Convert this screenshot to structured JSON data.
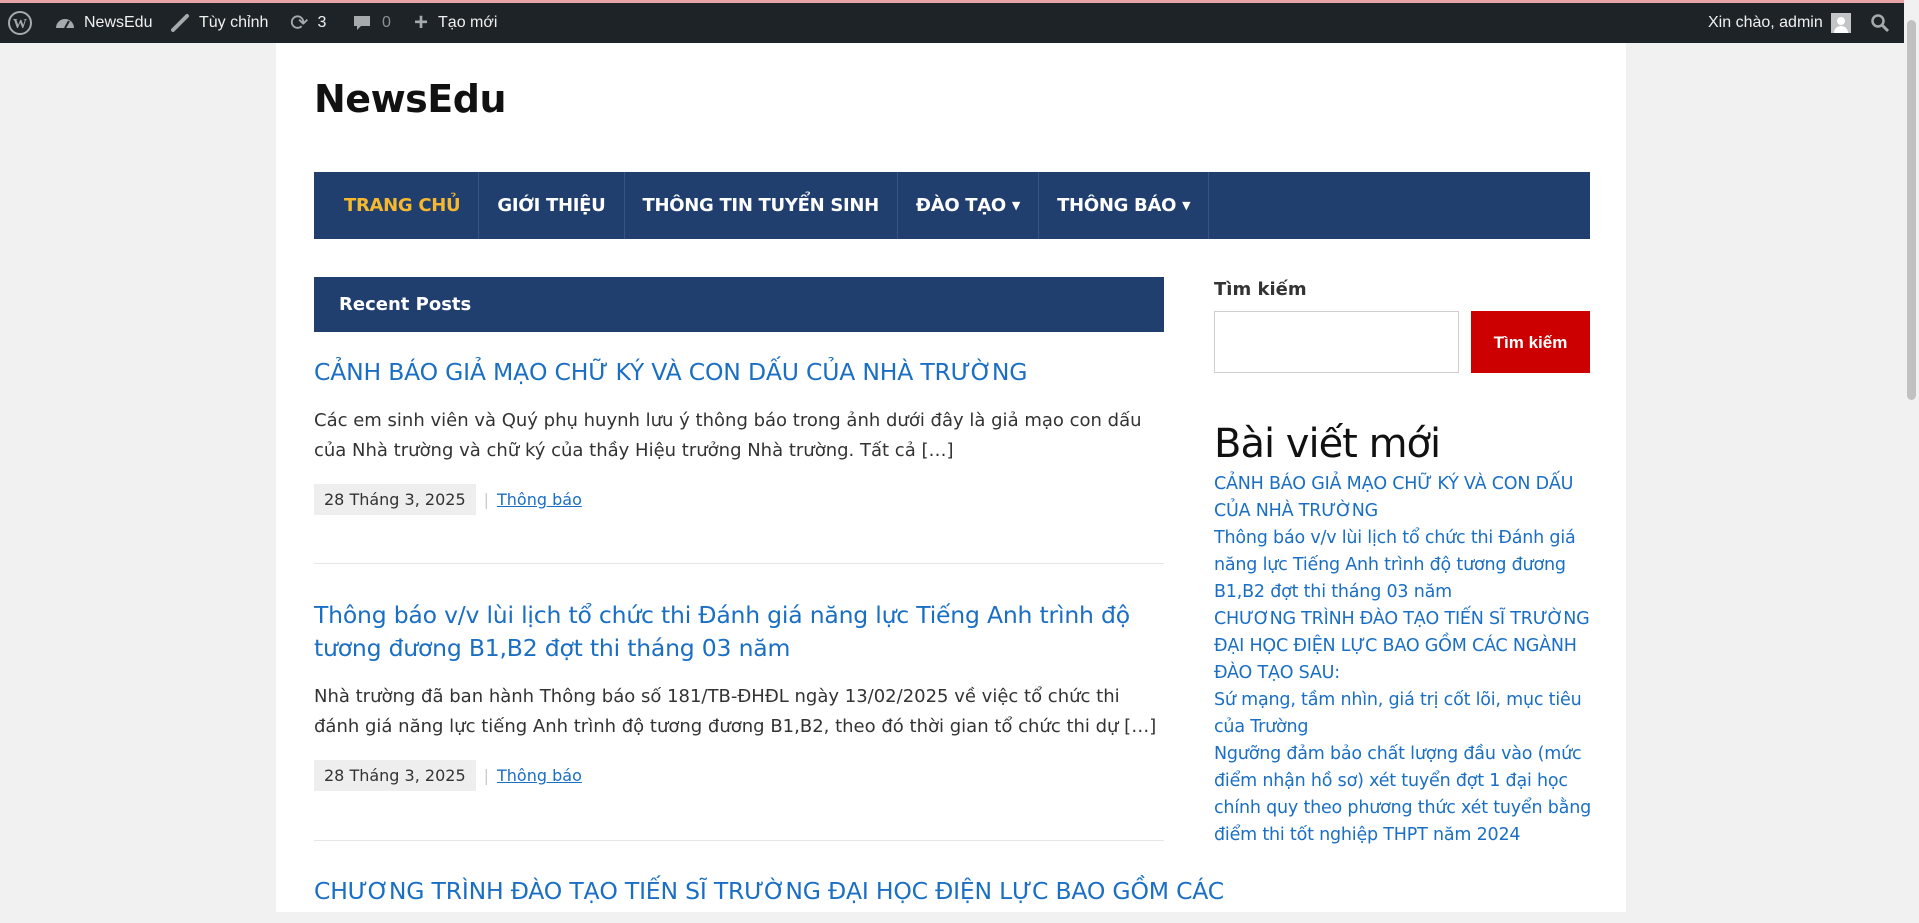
{
  "admin_bar": {
    "site_name": "NewsEdu",
    "customize_label": "Tùy chỉnh",
    "updates_count": "3",
    "comments_count": "0",
    "new_label": "Tạo mới",
    "greeting": "Xin chào, admin"
  },
  "site": {
    "title": "NewsEdu"
  },
  "nav": {
    "items": [
      {
        "label": "TRANG CHỦ"
      },
      {
        "label": "GIỚI THIỆU"
      },
      {
        "label": "THÔNG TIN TUYỂN SINH"
      },
      {
        "label": "ĐÀO TẠO"
      },
      {
        "label": "THÔNG BÁO"
      }
    ]
  },
  "main": {
    "section_title": "Recent Posts",
    "posts": [
      {
        "title": "CẢNH BÁO GIẢ MẠO CHỮ KÝ VÀ CON DẤU CỦA NHÀ TRƯỜNG",
        "excerpt": "Các em sinh viên và Quý phụ huynh lưu ý thông báo trong ảnh dưới đây là giả mạo con dấu của Nhà trường và chữ ký của thầy Hiệu trưởng Nhà trường. Tất cả […]",
        "date": "28 Tháng 3, 2025",
        "category": "Thông báo"
      },
      {
        "title": "Thông báo v/v lùi lịch tổ chức thi Đánh giá năng lực Tiếng Anh trình độ tương đương B1,B2 đợt thi tháng 03 năm",
        "excerpt": "Nhà trường đã ban hành Thông báo số 181/TB-ĐHĐL ngày 13/02/2025 về việc tổ chức thi đánh giá năng lực tiếng Anh trình độ tương đương B1,B2, theo đó thời gian tổ chức thi dự […]",
        "date": "28 Tháng 3, 2025",
        "category": "Thông báo"
      },
      {
        "title": "CHƯƠNG TRÌNH ĐÀO TẠO TIẾN SĨ TRƯỜNG ĐẠI HỌC ĐIỆN LỰC BAO GỒM CÁC"
      }
    ]
  },
  "sidebar": {
    "search_label": "Tìm kiếm",
    "search_placeholder": "",
    "search_button": "Tìm kiếm",
    "recent_title": "Bài viết mới",
    "recent_items": [
      "CẢNH BÁO GIẢ MẠO CHỮ KÝ VÀ CON DẤU CỦA NHÀ TRƯỜNG",
      "Thông báo v/v lùi lịch tổ chức thi Đánh giá năng lực Tiếng Anh trình độ tương đương B1,B2 đợt thi tháng 03 năm",
      "CHƯƠNG TRÌNH ĐÀO TẠO TIẾN SĨ TRƯỜNG ĐẠI HỌC ĐIỆN LỰC BAO GỒM CÁC NGÀNH ĐÀO TẠO SAU:",
      "Sứ mạng, tầm nhìn, giá trị cốt lõi, mục tiêu của Trường",
      "Ngưỡng đảm bảo chất lượng đầu vào (mức điểm nhận hồ sơ) xét tuyển đợt 1 đại học chính quy theo phương thức xét tuyển bằng điểm thi tốt nghiệp THPT năm 2024"
    ]
  },
  "colors": {
    "admin_bar_bg": "#1d2327",
    "nav_bg": "#203f6f",
    "nav_active": "#f5b82e",
    "link": "#1a6fc4",
    "search_button_bg": "#cc0000"
  }
}
